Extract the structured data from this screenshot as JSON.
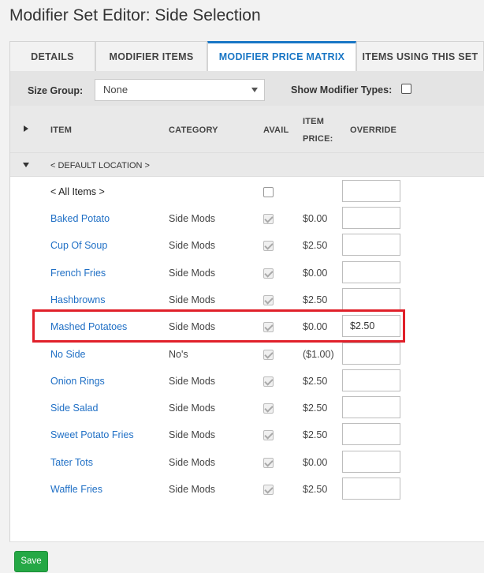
{
  "page": {
    "title": "Modifier Set Editor: Side Selection"
  },
  "tabs": [
    {
      "label": "DETAILS"
    },
    {
      "label": "MODIFIER ITEMS"
    },
    {
      "label": "MODIFIER PRICE MATRIX",
      "active": true
    },
    {
      "label": "ITEMS USING THIS SET"
    }
  ],
  "filters": {
    "size_group_label": "Size Group:",
    "size_group_value": "None",
    "show_modifier_types_label": "Show Modifier Types:",
    "show_modifier_types_checked": false
  },
  "table": {
    "headers": {
      "item": "ITEM",
      "category": "CATEGORY",
      "avail": "AVAIL",
      "item_price_line1": "ITEM",
      "item_price_line2": "PRICE:",
      "override": "OVERRIDE"
    },
    "group_label": "< DEFAULT LOCATION >",
    "rows": [
      {
        "item": "< All Items >",
        "category": "",
        "avail": false,
        "price": "",
        "override": ""
      },
      {
        "item": "Baked Potato",
        "category": "Side Mods",
        "avail": true,
        "price": "$0.00",
        "override": ""
      },
      {
        "item": "Cup Of Soup",
        "category": "Side Mods",
        "avail": true,
        "price": "$2.50",
        "override": ""
      },
      {
        "item": "French Fries",
        "category": "Side Mods",
        "avail": true,
        "price": "$0.00",
        "override": ""
      },
      {
        "item": "Hashbrowns",
        "category": "Side Mods",
        "avail": true,
        "price": "$2.50",
        "override": ""
      },
      {
        "item": "Mashed Potatoes",
        "category": "Side Mods",
        "avail": true,
        "price": "$0.00",
        "override": "$2.50"
      },
      {
        "item": "No Side",
        "category": "No's",
        "avail": true,
        "price": "($1.00)",
        "override": ""
      },
      {
        "item": "Onion Rings",
        "category": "Side Mods",
        "avail": true,
        "price": "$2.50",
        "override": ""
      },
      {
        "item": "Side Salad",
        "category": "Side Mods",
        "avail": true,
        "price": "$2.50",
        "override": ""
      },
      {
        "item": "Sweet Potato Fries",
        "category": "Side Mods",
        "avail": true,
        "price": "$2.50",
        "override": ""
      },
      {
        "item": "Tater Tots",
        "category": "Side Mods",
        "avail": true,
        "price": "$0.00",
        "override": ""
      },
      {
        "item": "Waffle Fries",
        "category": "Side Mods",
        "avail": true,
        "price": "$2.50",
        "override": ""
      }
    ]
  },
  "footer": {
    "save_label": "Save"
  },
  "colors": {
    "accent": "#1976c5",
    "highlight": "#e0202a",
    "save": "#25a845"
  }
}
